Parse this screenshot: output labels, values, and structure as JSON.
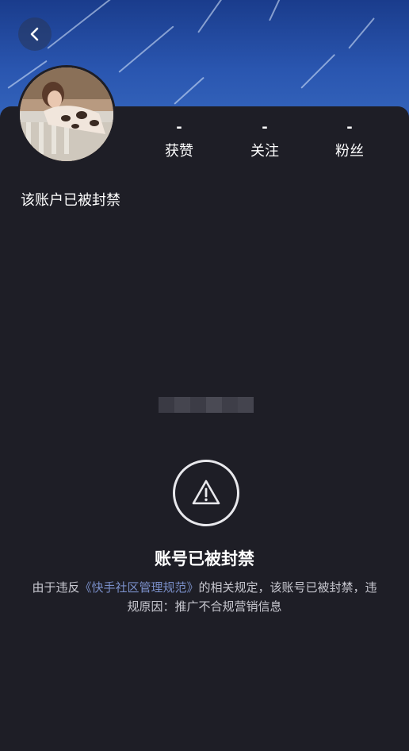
{
  "header": {
    "back_icon": "chevron-left-icon"
  },
  "profile": {
    "avatar_alt": "avatar"
  },
  "stats": [
    {
      "value": "-",
      "label": "获赞"
    },
    {
      "value": "-",
      "label": "关注"
    },
    {
      "value": "-",
      "label": "粉丝"
    }
  ],
  "account": {
    "status_text": "该账户已被封禁"
  },
  "ban_notice": {
    "icon": "warning-icon",
    "title": "账号已被封禁",
    "desc_prefix": "由于违反",
    "desc_link": "《快手社区管理规范》",
    "desc_suffix": "的相关规定，该账号已被封禁，违规原因：推广不合规营销信息"
  },
  "colors": {
    "background": "#1e1e26",
    "banner": "#2a56b0",
    "link": "#7a8fc9"
  }
}
